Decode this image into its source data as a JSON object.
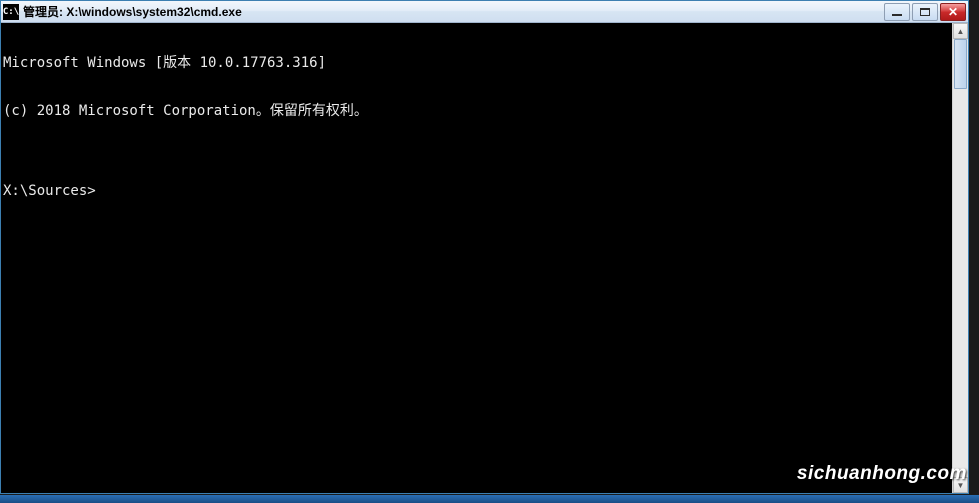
{
  "window": {
    "icon_label": "C:\\",
    "title": "管理员: X:\\windows\\system32\\cmd.exe"
  },
  "terminal": {
    "line1": "Microsoft Windows [版本 10.0.17763.316]",
    "line2": "(c) 2018 Microsoft Corporation。保留所有权利。",
    "blank": "",
    "prompt": "X:\\Sources>"
  },
  "watermark": "sichuanhong.com"
}
